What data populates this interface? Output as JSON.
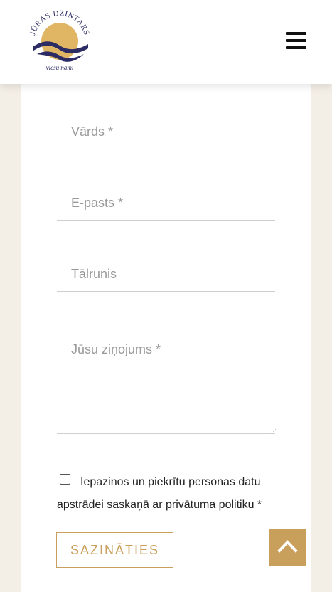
{
  "header": {
    "logo": {
      "brand_text": "JŪRAS DZINTARS",
      "tagline": "viesu nami",
      "colors": {
        "sun": "#e0b665",
        "waves": "#2d2b63"
      }
    },
    "menu_icon": "hamburger-icon"
  },
  "form": {
    "name_placeholder": "Vārds *",
    "email_placeholder": "E-pasts *",
    "phone_placeholder": "Tālrunis",
    "message_placeholder": "Jūsu ziņojums *",
    "consent_label": "Iepazinos un piekrītu personas datu apstrādei saskaņā ar privātuma politiku *",
    "consent_checked": false,
    "submit_label": "SAZINĀTIES"
  },
  "back_to_top_icon": "chevron-up-icon",
  "colors": {
    "accent": "#c9a05b",
    "page_background": "#f3eee6",
    "card_background": "#ffffff"
  }
}
